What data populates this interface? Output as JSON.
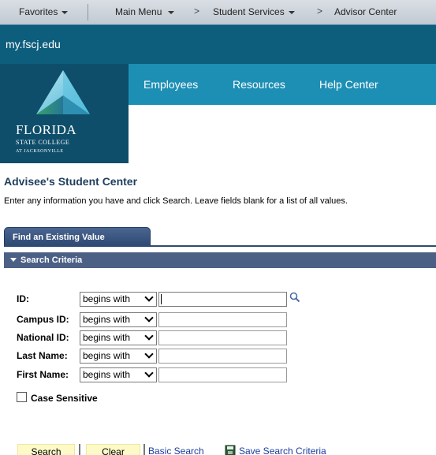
{
  "topnav": {
    "favorites": "Favorites",
    "main_menu": "Main Menu",
    "sep1": ">",
    "student_services": "Student Services",
    "sep2": ">",
    "advisor_center": "Advisor Center"
  },
  "header": {
    "domain": "my.fscj.edu",
    "logo": {
      "line1": "FLORIDA",
      "line2": "STATE COLLEGE",
      "line3": "AT JACKSONVILLE"
    },
    "menu": [
      "Employees",
      "Resources",
      "Help Center"
    ]
  },
  "page": {
    "title": "Advisee's Student Center",
    "instructions": "Enter any information you have and click Search. Leave fields blank for a list of all values.",
    "tab_label": "Find an Existing Value",
    "section_label": "Search Criteria"
  },
  "search_fields": [
    {
      "label": "ID:",
      "operator": "begins with",
      "value": ""
    },
    {
      "label": "Campus ID:",
      "operator": "begins with",
      "value": ""
    },
    {
      "label": "National ID:",
      "operator": "begins with",
      "value": ""
    },
    {
      "label": "Last Name:",
      "operator": "begins with",
      "value": ""
    },
    {
      "label": "First Name:",
      "operator": "begins with",
      "value": ""
    }
  ],
  "case_sensitive": {
    "label": "Case Sensitive",
    "checked": false
  },
  "actions": {
    "search": "Search",
    "clear": "Clear",
    "basic_search": "Basic Search",
    "save_search": "Save Search Criteria"
  },
  "colors": {
    "domain_bar": "#0d5d7d",
    "menu_bar": "#1d8fb5",
    "section_bar": "#4c6086",
    "button_bg": "#fdfac8",
    "link": "#1a3d9e"
  },
  "icons": [
    "lookup-icon",
    "save-icon",
    "caret-down-icon"
  ]
}
